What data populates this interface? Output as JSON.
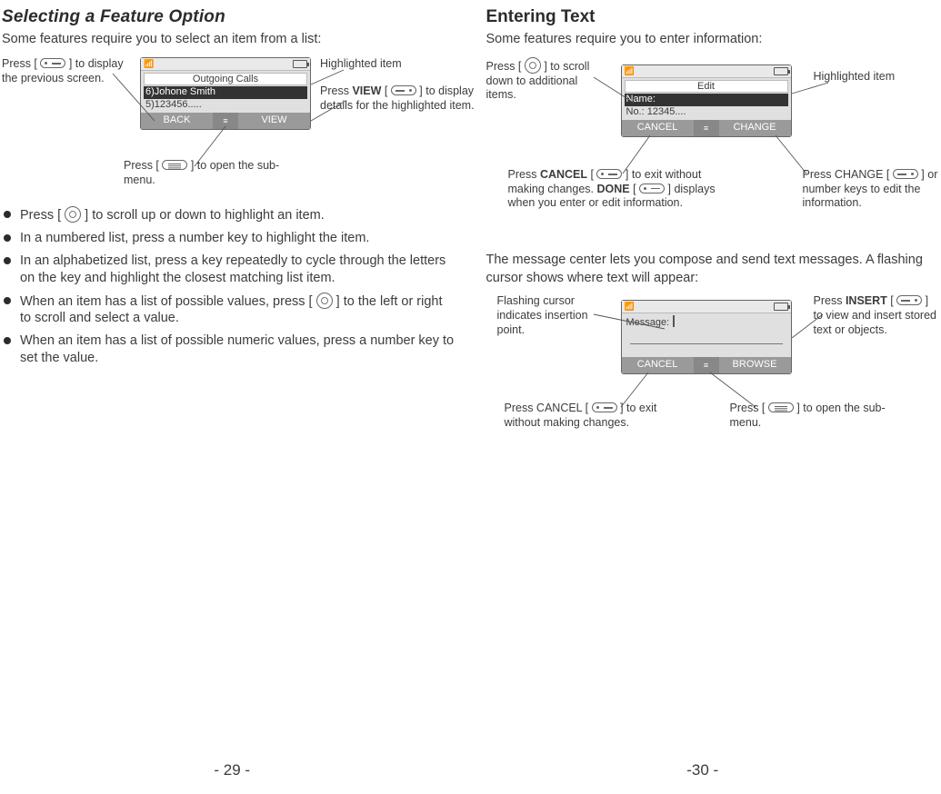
{
  "left": {
    "heading": "Selecting a Feature Option",
    "intro": "Some features require you to select an item from a list:",
    "screen1": {
      "title": "Outgoing Calls",
      "item_hl": "6)Johone Smith",
      "item2": "5)123456.....",
      "soft_left": "BACK",
      "soft_right": "VIEW"
    },
    "call_back": "Press [ key ] to display the previous screen.",
    "call_hl": "Highlighted item",
    "call_view_a": "Press ",
    "call_view_b": "VIEW",
    "call_view_c": " [ key ] to display details for the highlighted item.",
    "call_sub": "Press [ key ] to open the sub-menu.",
    "bullets": [
      "Press [ key ] to scroll up or down to highlight an item.",
      "In a numbered list, press a number key to highlight the item.",
      "In an alphabetized list, press a key repeatedly to cycle through the letters on the key and highlight the closest matching list item.",
      "When an item has a list of possible values, press [ key ] to the left or right to scroll and select a value.",
      "When an item has a list of possible numeric values, press a number key to set the value."
    ],
    "pagenum": "- 29 -"
  },
  "right": {
    "heading": "Entering Text",
    "intro": "Some features require you to enter information:",
    "screen2": {
      "title": "Edit",
      "item_hl": "Name:",
      "item2": "No.: 12345....",
      "soft_left": "CANCEL",
      "soft_right": "CHANGE"
    },
    "call_scroll": "Press [ key ] to scroll down to additional items.",
    "call_hl": "Highlighted item",
    "call_cancel_a": "Press ",
    "call_cancel_b": "CANCEL",
    "call_cancel_c": " [ key ] to exit without making changes. ",
    "call_cancel_d": "DONE",
    "call_cancel_e": " [ key ] displays when you enter or edit information.",
    "call_change": "Press CHANGE [ key ] or number keys to edit the information.",
    "para2": "The message center lets you compose and send text messages.  A flashing cursor shows where text will appear:",
    "screen3": {
      "title": "Message:",
      "soft_left": "CANCEL",
      "soft_right": "BROWSE"
    },
    "call_cursor": "Flashing cursor indicates insertion point.",
    "call_insert_a": "Press ",
    "call_insert_b": "INSERT",
    "call_insert_c": " [ key ] to view and insert stored text or objects.",
    "call_cancel2": "Press CANCEL [ key ] to exit without making changes.",
    "call_sub2": "Press [ key ] to open the sub-menu.",
    "pagenum": "-30 -"
  }
}
